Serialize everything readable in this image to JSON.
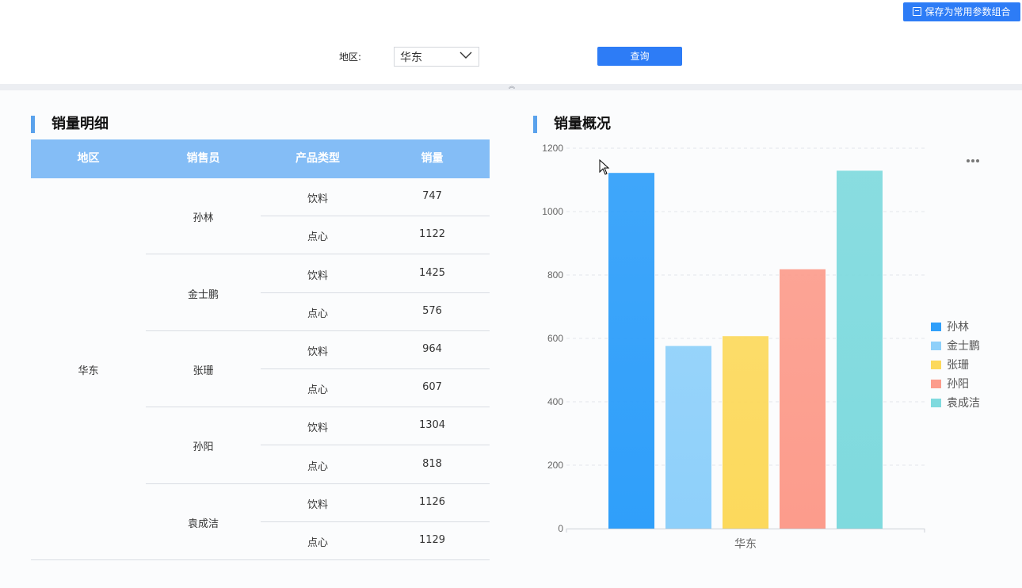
{
  "toolbar": {
    "save_label": "保存为常用参数组合"
  },
  "filter": {
    "region_label": "地区:",
    "region_value": "华东",
    "query_label": "查询"
  },
  "sections": {
    "table_title": "销量明细",
    "chart_title": "销量概况"
  },
  "table": {
    "headers": [
      "地区",
      "销售员",
      "产品类型",
      "销量"
    ],
    "region": "华东",
    "salespeople": [
      {
        "name": "孙林",
        "rows": [
          {
            "type": "饮料",
            "sales": "747"
          },
          {
            "type": "点心",
            "sales": "1122"
          }
        ]
      },
      {
        "name": "金士鹏",
        "rows": [
          {
            "type": "饮料",
            "sales": "1425"
          },
          {
            "type": "点心",
            "sales": "576"
          }
        ]
      },
      {
        "name": "张珊",
        "rows": [
          {
            "type": "饮料",
            "sales": "964"
          },
          {
            "type": "点心",
            "sales": "607"
          }
        ]
      },
      {
        "name": "孙阳",
        "rows": [
          {
            "type": "饮料",
            "sales": "1304"
          },
          {
            "type": "点心",
            "sales": "818"
          }
        ]
      },
      {
        "name": "袁成洁",
        "rows": [
          {
            "type": "饮料",
            "sales": "1126"
          },
          {
            "type": "点心",
            "sales": "1129"
          }
        ]
      }
    ]
  },
  "chart_data": {
    "type": "bar",
    "categories": [
      "华东"
    ],
    "series": [
      {
        "name": "孙林",
        "values": [
          1122
        ],
        "color": "#2f9ffa"
      },
      {
        "name": "金士鹏",
        "values": [
          576
        ],
        "color": "#8ed0fa"
      },
      {
        "name": "张珊",
        "values": [
          607
        ],
        "color": "#fcd95c"
      },
      {
        "name": "孙阳",
        "values": [
          818
        ],
        "color": "#fc9c8c"
      },
      {
        "name": "袁成洁",
        "values": [
          1129
        ],
        "color": "#7fdade"
      }
    ],
    "ylim": [
      0,
      1200
    ],
    "yticks": [
      "0",
      "200",
      "400",
      "600",
      "800",
      "1000",
      "1200"
    ],
    "grid": true,
    "legend_position": "right"
  },
  "icons": {
    "more": "more-horizontal-icon",
    "save": "floppy-disk-icon",
    "dropdown": "chevron-down-icon",
    "collapse": "double-chevron-up-icon",
    "cursor": "mouse-pointer-icon"
  }
}
